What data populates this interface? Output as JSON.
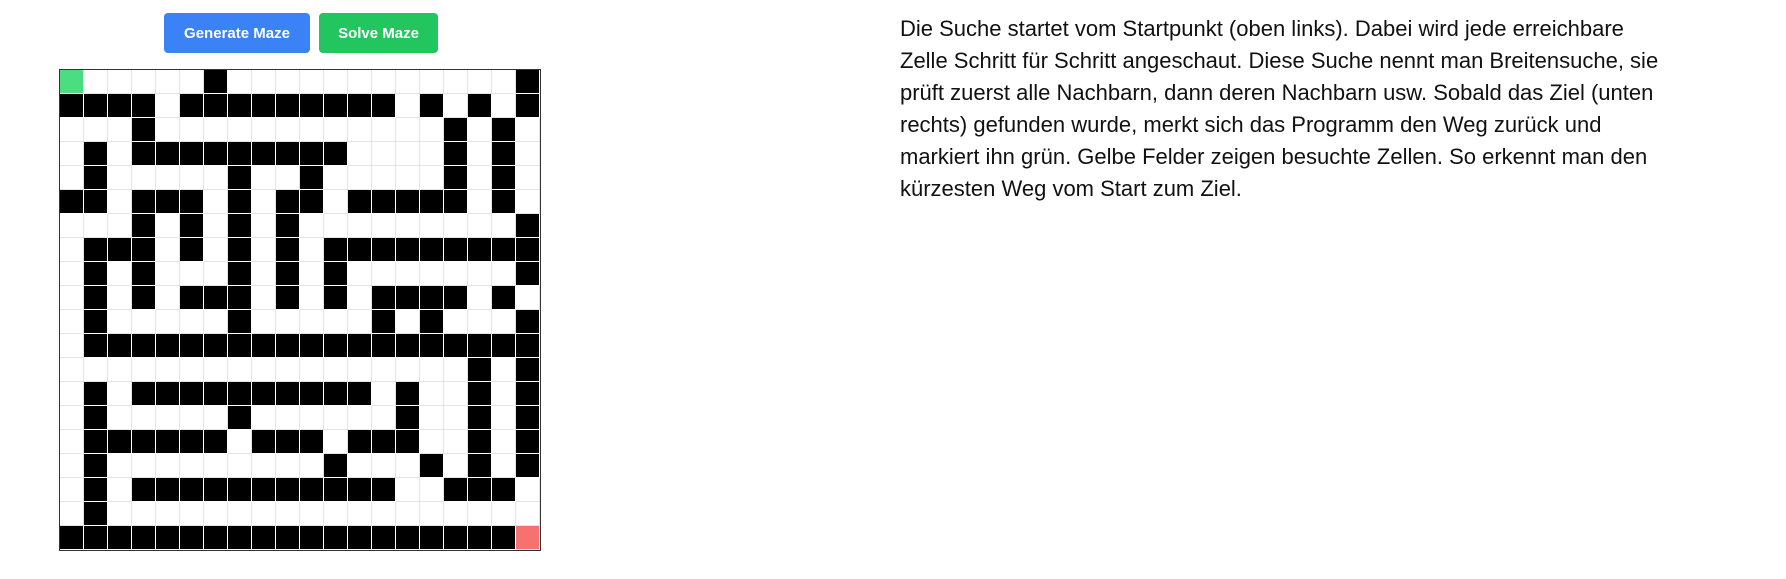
{
  "toolbar": {
    "generate_label": "Generate Maze",
    "solve_label": "Solve Maze",
    "generate_color": "#3b82f6",
    "solve_color": "#22c55e"
  },
  "maze": {
    "rows": 20,
    "cols": 20,
    "start_color": "#4ade80",
    "end_color": "#f87171",
    "wall_color": "#000000",
    "grid": [
      "S.....#............#",
      "####.#########.#.#.#",
      "...#............#.#.",
      ".#.#########....#.#.",
      ".#.....#..#.....#.#.",
      "##.###.#.##.#####.#.",
      "...#.#.#.#.........#",
      ".###.#.#.#.#########",
      ".#.#...#.#.#.......#",
      ".#.#.###.#.#.####.#.",
      ".#.....#.....#.#...#",
      ".###################",
      ".................#.#",
      ".#.##########.#..#.#",
      ".#.....#......#..#.#",
      ".######.###.###..#.#",
      ".#.........#...#.#.#",
      ".#.###########..###.",
      ".#..................",
      "###################E"
    ]
  },
  "description": "Die Suche startet vom Startpunkt (oben links). Dabei wird jede erreichbare Zelle Schritt für Schritt angeschaut. Diese Suche nennt man Breitensuche, sie prüft zuerst alle Nachbarn, dann deren Nachbarn usw. Sobald das Ziel (unten rechts) gefunden wurde, merkt sich das Programm den Weg zurück und markiert ihn grün. Gelbe Felder zeigen besuchte Zellen. So erkennt man den kürzesten Weg vom Start zum Ziel."
}
